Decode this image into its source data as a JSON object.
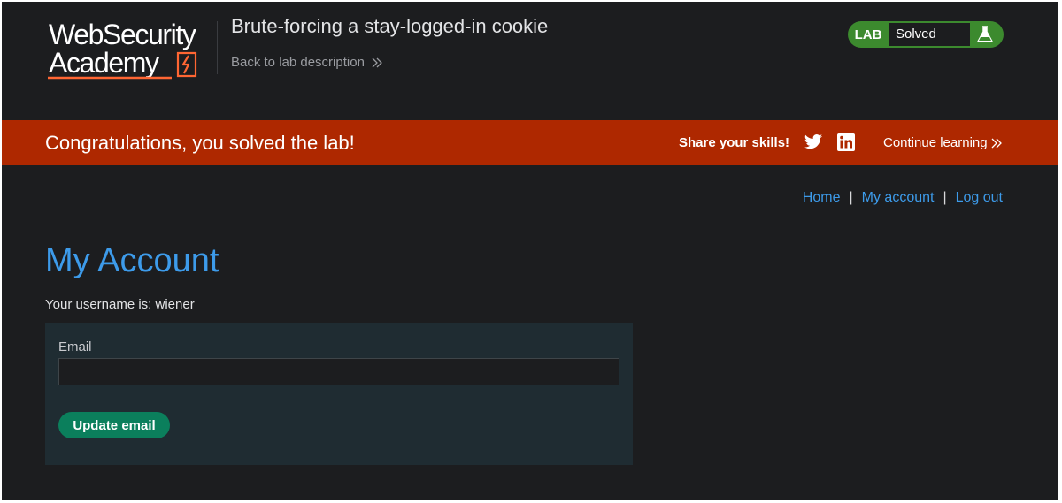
{
  "header": {
    "logo_line1": "WebSecurity",
    "logo_line2": "Academy",
    "lab_title": "Brute-forcing a stay-logged-in cookie",
    "back_link": "Back to lab description",
    "status": {
      "label": "LAB",
      "value": "Solved",
      "icon": "flask-icon"
    }
  },
  "banner": {
    "message": "Congratulations, you solved the lab!",
    "share_label": "Share your skills!",
    "social_icons": [
      "twitter-icon",
      "linkedin-icon"
    ],
    "continue_label": "Continue learning"
  },
  "nav": {
    "home": "Home",
    "separator": "|",
    "my_account": "My account",
    "log_out": "Log out"
  },
  "main": {
    "title": "My Account",
    "username_line": "Your username is: wiener",
    "email_label": "Email",
    "email_value": "",
    "update_button": "Update email"
  },
  "colors": {
    "background": "#1c1d1f",
    "banner": "#ae2800",
    "link": "#3d9bea",
    "status_green": "#3c8a2e",
    "button_green": "#0b7f5c",
    "panel": "#1f2c32",
    "logo_accent": "#ff6633"
  }
}
